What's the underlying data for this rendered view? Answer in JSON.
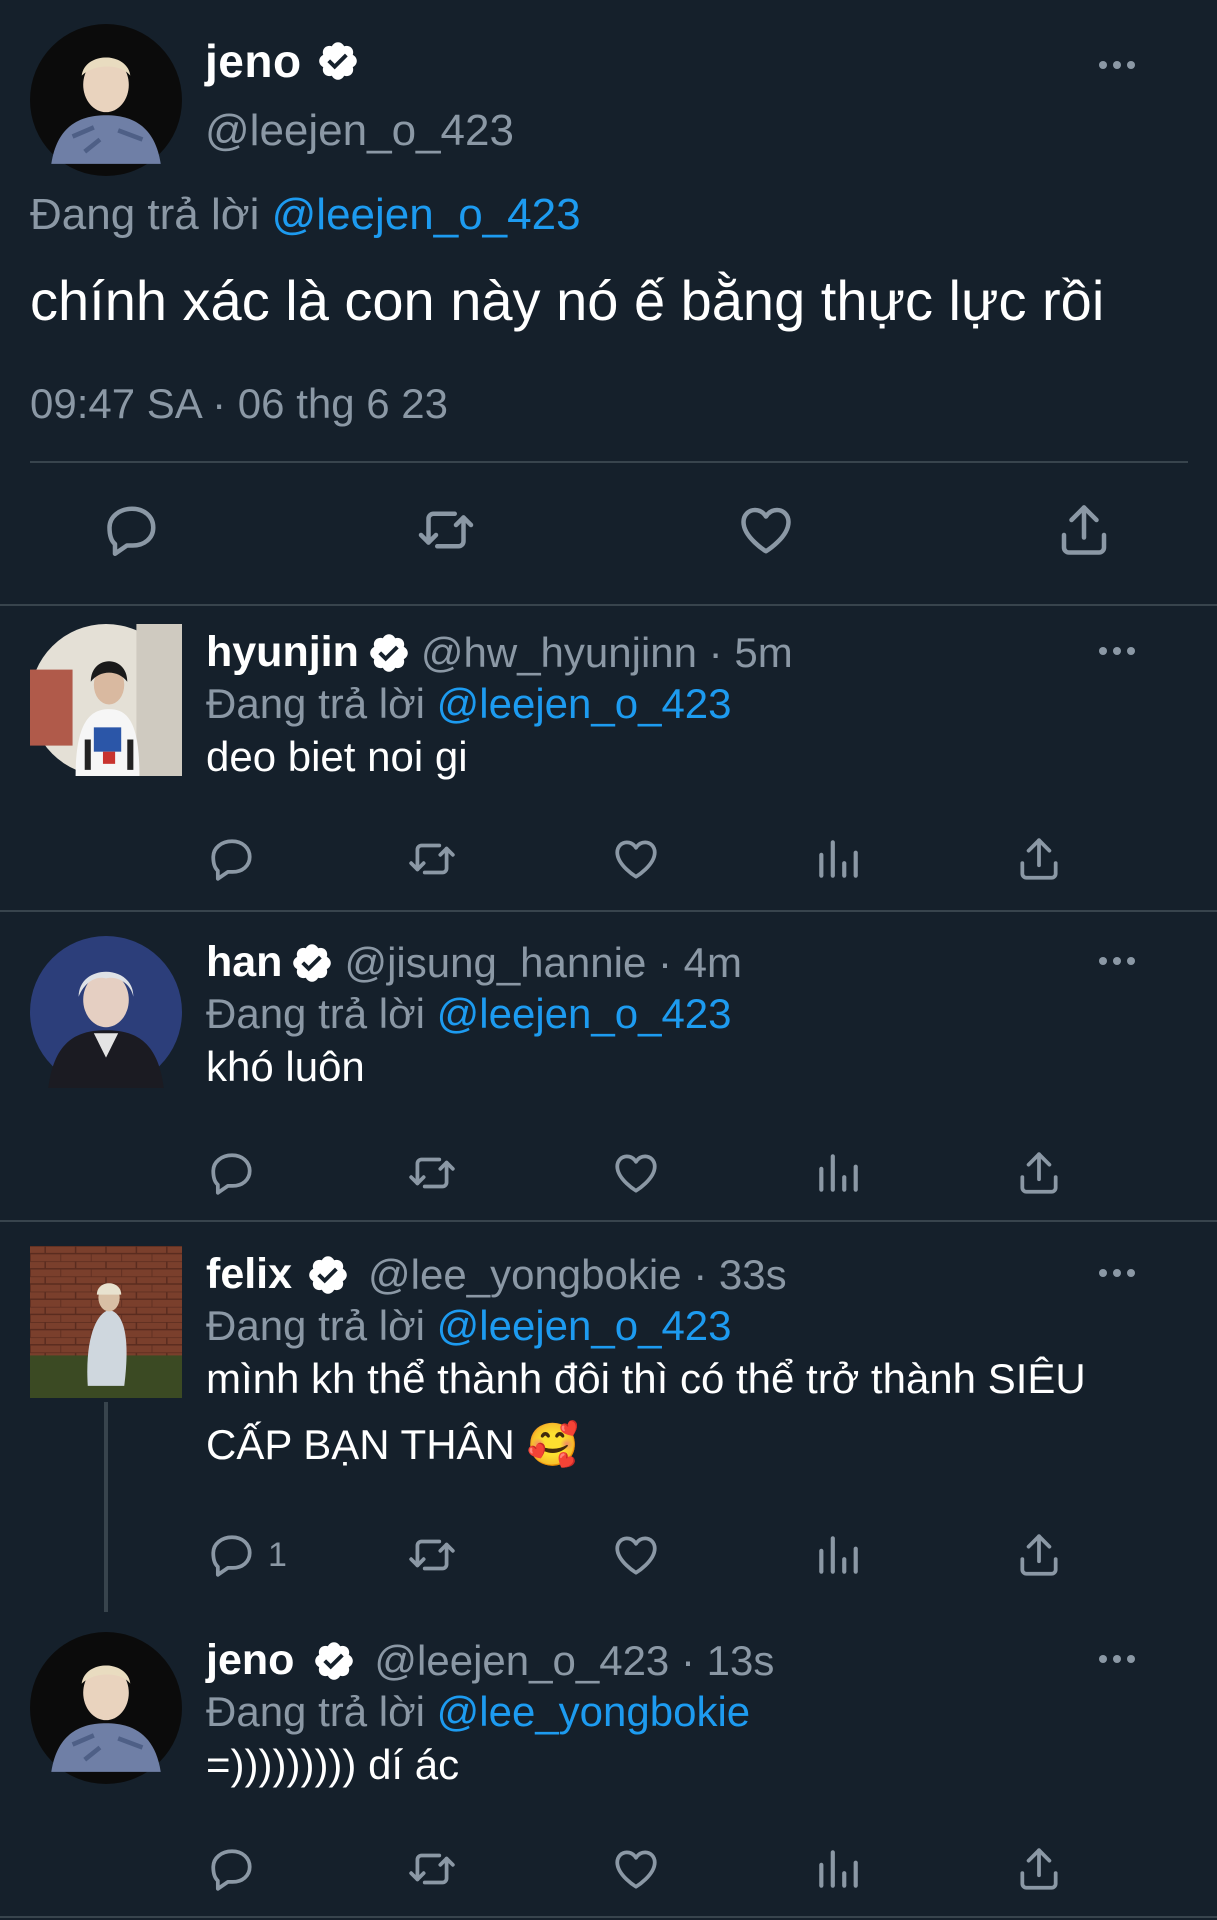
{
  "main_tweet": {
    "name": "jeno",
    "handle": "@leejen_o_423",
    "reply_prefix": "Đang trả lời",
    "reply_to": "@leejen_o_423",
    "text": "chính xác là con này nó ế bằng thực lực rồi",
    "time": "09:47 SA · 06 thg 6 23",
    "avatar": "profile photo",
    "actions": [
      "reply-icon",
      "retweet-icon",
      "like-icon",
      "share-icon"
    ]
  },
  "replies": [
    {
      "name": "hyunjin",
      "handle": "@hw_hyunjinn · 5m",
      "reply_prefix": "Đang trả lời",
      "reply_to": "@leejen_o_423",
      "text": "deo biet noi gi",
      "reply_count": ""
    },
    {
      "name": "han",
      "handle": "@jisung_hannie · 4m",
      "reply_prefix": "Đang trả lời",
      "reply_to": "@leejen_o_423",
      "text": "khó luôn",
      "reply_count": ""
    },
    {
      "name": "felix",
      "handle": "@lee_yongbokie · 33s",
      "reply_prefix": "Đang trả lời",
      "reply_to": "@leejen_o_423",
      "text": "mình kh thể thành đôi thì có thể trở thành SIÊU CẤP BẠN THÂN 🥰",
      "reply_count": "1"
    },
    {
      "name": "jeno",
      "handle": "@leejen_o_423 · 13s",
      "reply_prefix": "Đang trả lời",
      "reply_to": "@lee_yongbokie",
      "text": "=))))))))) dí ác",
      "reply_count": ""
    }
  ],
  "colors": {
    "background": "#15202b",
    "text": "#ffffff",
    "muted": "#8b98a5",
    "link": "#1d9bf0",
    "divider": "#38444d"
  }
}
